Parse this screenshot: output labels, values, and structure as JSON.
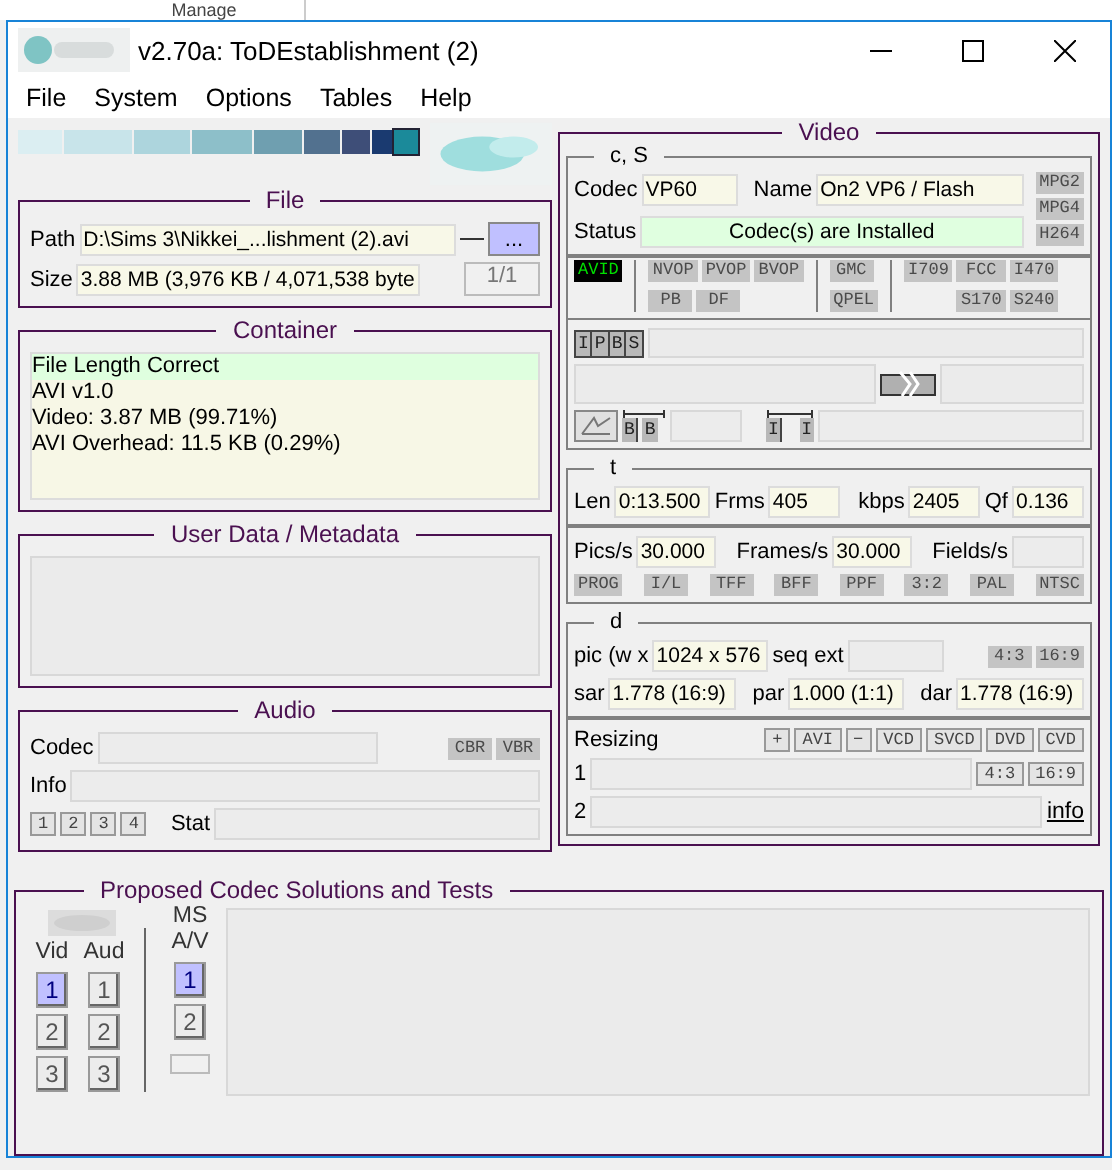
{
  "background_window": {
    "tab": "Manage"
  },
  "window": {
    "title": "v2.70a: ToDEstablishment (2)"
  },
  "menu": [
    "File",
    "System",
    "Options",
    "Tables",
    "Help"
  ],
  "file": {
    "title": "File",
    "path_label": "Path",
    "path": "D:\\Sims 3\\Nikkei_...lishment (2).avi",
    "browse": "...",
    "size_label": "Size",
    "size": "3.88 MB (3,976 KB / 4,071,538 byte",
    "counter": "1/1"
  },
  "container": {
    "title": "Container",
    "lines": [
      {
        "text": "File Length Correct",
        "highlighted": true
      },
      {
        "text": "AVI v1.0",
        "highlighted": false
      },
      {
        "text": "Video: 3.87 MB (99.71%)",
        "highlighted": false
      },
      {
        "text": "AVI Overhead: 11.5 KB (0.29%)",
        "highlighted": false
      }
    ]
  },
  "metadata": {
    "title": "User Data / Metadata"
  },
  "audio": {
    "title": "Audio",
    "codec_label": "Codec",
    "flags": [
      {
        "label": "CBR",
        "on": false
      },
      {
        "label": "VBR",
        "on": false
      }
    ],
    "info_label": "Info",
    "streams": [
      "1",
      "2",
      "3",
      "4"
    ],
    "stat_label": "Stat"
  },
  "video": {
    "title": "Video",
    "codec_section": {
      "title": "c, S",
      "codec_label": "Codec",
      "codec": "VP60",
      "name_label": "Name",
      "name": "On2 VP6 / Flash",
      "status_label": "Status",
      "status": "Codec(s) are Installed",
      "formats": [
        {
          "label": "MPG2",
          "on": false
        },
        {
          "label": "MPG4",
          "on": false
        },
        {
          "label": "H264",
          "on": false
        }
      ]
    },
    "flag_groups": [
      {
        "rows": [
          [
            {
              "label": "AVID",
              "on": true
            }
          ]
        ]
      },
      {
        "rows": [
          [
            {
              "label": "NVOP",
              "on": false
            },
            {
              "label": "PVOP",
              "on": false
            },
            {
              "label": "BVOP",
              "on": false
            }
          ],
          [
            {
              "label": "PB",
              "on": false
            },
            {
              "label": "DF",
              "on": false
            }
          ]
        ]
      },
      {
        "rows": [
          [
            {
              "label": "GMC",
              "on": false
            }
          ],
          [
            {
              "label": "QPEL",
              "on": false
            }
          ]
        ]
      },
      {
        "rows": [
          [
            {
              "label": "I709",
              "on": false
            },
            {
              "label": "FCC",
              "on": false
            },
            {
              "label": "I470",
              "on": false
            }
          ],
          [
            null,
            {
              "label": "S170",
              "on": false
            },
            {
              "label": "S240",
              "on": false
            }
          ]
        ]
      }
    ],
    "frame_types": [
      "I",
      "P",
      "B",
      "S"
    ],
    "b_frames": [
      "B",
      "B"
    ],
    "i_frames": [
      "I",
      "I"
    ],
    "timing": {
      "title": "t",
      "len_label": "Len",
      "len": "0:13.500",
      "frms_label": "Frms",
      "frms": "405",
      "kbps_label": "kbps",
      "kbps": "2405",
      "qf_label": "Qf",
      "qf": "0.136",
      "pics_label": "Pics/s",
      "pics": "30.000",
      "frames_label": "Frames/s",
      "frames": "30.000",
      "fields_label": "Fields/s",
      "flags": [
        {
          "label": "PROG",
          "on": false
        },
        {
          "label": "I/L",
          "on": false
        },
        {
          "label": "TFF",
          "on": false
        },
        {
          "label": "BFF",
          "on": false
        },
        {
          "label": "PPF",
          "on": false
        },
        {
          "label": "3:2",
          "on": false
        },
        {
          "label": "PAL",
          "on": false
        },
        {
          "label": "NTSC",
          "on": false
        }
      ]
    },
    "dimensions": {
      "title": "d",
      "pic_label": "pic (w x",
      "pic": "1024 x 576",
      "seq_label": "seq ext",
      "aspect_flags": [
        {
          "label": "4:3",
          "on": false
        },
        {
          "label": "16:9",
          "on": false
        }
      ],
      "sar_label": "sar",
      "sar": "1.778 (16:9)",
      "par_label": "par",
      "par": "1.000 (1:1)",
      "dar_label": "dar",
      "dar": "1.778 (16:9)"
    },
    "resizing": {
      "label": "Resizing",
      "buttons": [
        "+",
        "AVI",
        "−",
        "VCD",
        "SVCD",
        "DVD",
        "CVD"
      ],
      "row1_label": "1",
      "row1_buttons": [
        "4:3",
        "16:9"
      ],
      "row2_label": "2",
      "info_link": "info"
    }
  },
  "solutions": {
    "title": "Proposed Codec Solutions and Tests",
    "vid_label": "Vid",
    "aud_label": "Aud",
    "ms_label": "MS\nA/V",
    "vid": [
      {
        "label": "1",
        "selected": true
      },
      {
        "label": "2",
        "selected": false
      },
      {
        "label": "3",
        "selected": false
      }
    ],
    "aud": [
      {
        "label": "1",
        "selected": false
      },
      {
        "label": "2",
        "selected": false
      },
      {
        "label": "3",
        "selected": false
      }
    ],
    "ms": [
      {
        "label": "1",
        "selected": true
      },
      {
        "label": "2",
        "selected": false
      }
    ]
  }
}
